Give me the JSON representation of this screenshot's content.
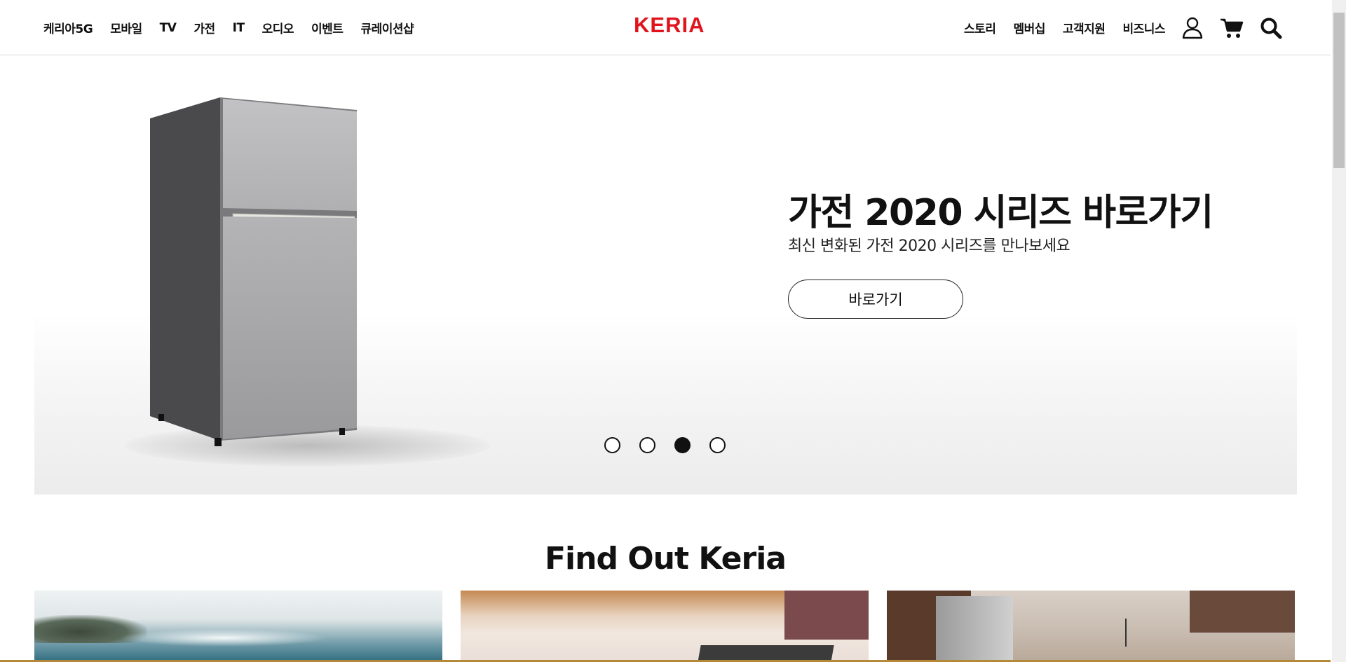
{
  "header": {
    "nav_left": [
      "케리아5G",
      "모바일",
      "TV",
      "가전",
      "IT",
      "오디오",
      "이벤트",
      "큐레이션샵"
    ],
    "logo": "KERIA",
    "nav_right": [
      "스토리",
      "멤버십",
      "고객지원",
      "비즈니스"
    ],
    "icons": [
      "user-icon",
      "cart-icon",
      "search-icon"
    ]
  },
  "hero": {
    "title": "가전 2020 시리즈 바로가기",
    "subtitle": "최신 변화된 가전 2020 시리즈를 만나보세요",
    "button_label": "바로가기",
    "slides_total": 4,
    "active_slide": 3
  },
  "section": {
    "title": "Find Out Keria"
  },
  "colors": {
    "brand": "#e1141e",
    "text": "#111111"
  }
}
